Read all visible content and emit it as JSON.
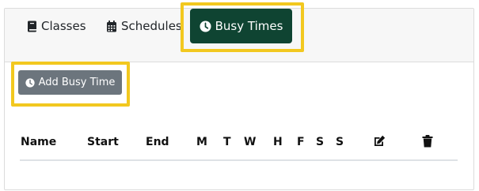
{
  "tabs": {
    "classes": {
      "label": "Classes",
      "icon": "book-icon"
    },
    "schedules": {
      "label": "Schedules",
      "icon": "calendar-icon"
    },
    "busy_times": {
      "label": "Busy Times",
      "icon": "clock-icon",
      "active": true
    }
  },
  "actions": {
    "add_busy_time": {
      "label": "Add Busy Time",
      "icon": "clock-icon"
    }
  },
  "table": {
    "headers": [
      "Name",
      "Start",
      "End",
      "M",
      "T",
      "W",
      "H",
      "F",
      "S",
      "S"
    ],
    "icon_headers": [
      "edit-icon",
      "trash-icon"
    ],
    "rows": []
  },
  "colors": {
    "active_tab": "#0f4432",
    "secondary_button": "#6c757d",
    "highlight": "#f2c81f"
  }
}
